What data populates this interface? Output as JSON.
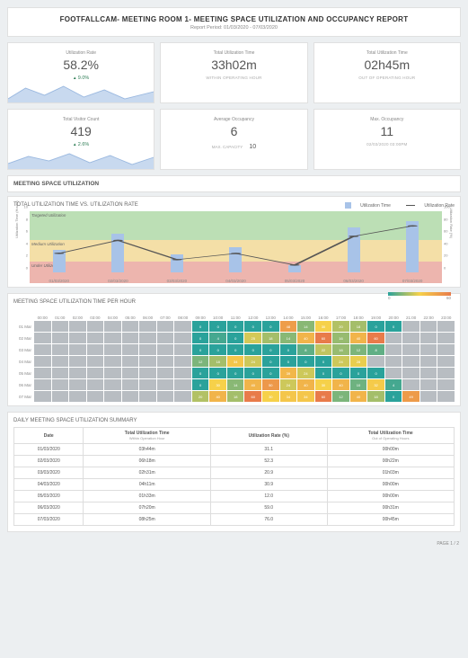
{
  "header": {
    "title": "FOOTFALLCAM- MEETING ROOM 1- MEETING SPACE UTILIZATION AND OCCUPANCY REPORT",
    "period": "Report Period: 01/03/2020 - 07/03/2020"
  },
  "kpi": {
    "util_rate": {
      "label": "Utilization Rate",
      "value": "58.2%",
      "delta": "9.0%",
      "spark": true
    },
    "util_time_in": {
      "label": "Total Utilization Time",
      "value": "33h02m",
      "sub": "WITHIN OPERATING HOUR"
    },
    "util_time_out": {
      "label": "Total Utilization Time",
      "value": "02h45m",
      "sub": "OUT OF OPERATING HOUR"
    },
    "visitor": {
      "label": "Total Visitor Count",
      "value": "419",
      "delta": "2.6%",
      "spark": true
    },
    "avg_occ": {
      "label": "Average Occupancy",
      "value": "6",
      "cap_label": "MAX. CAPACITY",
      "cap_value": "10"
    },
    "max_occ": {
      "label": "Max. Occupancy",
      "value": "11",
      "sub": "02/03/2020 03:00PM"
    }
  },
  "sections": {
    "util_title": "MEETING SPACE UTILIZATION",
    "chart1_title": "TOTAL UTILIZATION TIME VS. UTILIZATION RATE",
    "chart2_title": "MEETING SPACE UTILIZATION TIME PER HOUR",
    "table_title": "DAILY MEETING SPACE UTILIZATION SUMMARY"
  },
  "legend1": {
    "a": "Utilization Time",
    "b": "Utilization Rate"
  },
  "bands": {
    "target": "Targeted Utilization",
    "medium": "Medium Utilization",
    "under": "Under Utilized"
  },
  "axis_left_label": "Utilization Time (Hours)",
  "axis_right_label": "Utilization Rate (%)",
  "heat_legend": {
    "min": "0",
    "max": "60"
  },
  "chart_data": {
    "type": "bar",
    "categories": [
      "01/03/2020",
      "02/03/2020",
      "03/03/2020",
      "04/03/2020",
      "05/03/2020",
      "06/03/2020",
      "07/03/2020"
    ],
    "series": [
      {
        "name": "Utilization Time (h)",
        "values": [
          3.7,
          6.3,
          2.9,
          4.1,
          1.2,
          7.4,
          8.4
        ]
      },
      {
        "name": "Utilization Rate (%)",
        "values": [
          31.1,
          52.3,
          20.9,
          30.9,
          12.0,
          59.0,
          76.0
        ]
      }
    ],
    "ylim_hours": [
      0,
      10
    ],
    "ylim_rate": [
      0,
      100
    ],
    "y_ticks_left": [
      0,
      2,
      4,
      6,
      8,
      10
    ],
    "y_ticks_right": [
      0,
      20,
      40,
      60,
      80,
      100
    ]
  },
  "heatmap": {
    "hours": [
      "00:00",
      "01:00",
      "02:00",
      "03:00",
      "04:00",
      "05:00",
      "06:00",
      "07:00",
      "08:00",
      "09:00",
      "10:00",
      "11:00",
      "12:00",
      "13:00",
      "14:00",
      "15:00",
      "16:00",
      "17:00",
      "18:00",
      "19:00",
      "20:00",
      "21:00",
      "22:00",
      "23:00"
    ],
    "rows": [
      {
        "label": "01 Mar",
        "cells": [
          -1,
          -1,
          -1,
          -1,
          -1,
          -1,
          -1,
          -1,
          -1,
          0,
          0,
          0,
          0,
          0,
          48,
          14,
          30,
          20,
          18,
          0,
          0,
          -1,
          -1,
          -1
        ]
      },
      {
        "label": "02 Mar",
        "cells": [
          -1,
          -1,
          -1,
          -1,
          -1,
          -1,
          -1,
          -1,
          -1,
          0,
          4,
          0,
          25,
          18,
          14,
          40,
          60,
          16,
          40,
          60,
          -1,
          -1,
          -1,
          -1
        ]
      },
      {
        "label": "03 Mar",
        "cells": [
          -1,
          -1,
          -1,
          -1,
          -1,
          -1,
          -1,
          -1,
          -1,
          0,
          0,
          0,
          0,
          0,
          0,
          8,
          22,
          16,
          12,
          8,
          -1,
          -1,
          -1,
          -1
        ]
      },
      {
        "label": "04 Mar",
        "cells": [
          -1,
          -1,
          -1,
          -1,
          -1,
          -1,
          -1,
          -1,
          -1,
          12,
          18,
          34,
          24,
          0,
          0,
          0,
          0,
          24,
          28,
          -1,
          -1,
          -1,
          -1,
          -1
        ]
      },
      {
        "label": "05 Mar",
        "cells": [
          -1,
          -1,
          -1,
          -1,
          -1,
          -1,
          -1,
          -1,
          -1,
          0,
          0,
          0,
          0,
          0,
          39,
          24,
          0,
          0,
          0,
          0,
          -1,
          -1,
          -1,
          -1
        ]
      },
      {
        "label": "06 Mar",
        "cells": [
          -1,
          -1,
          -1,
          -1,
          -1,
          -1,
          -1,
          -1,
          -1,
          0,
          30,
          14,
          40,
          50,
          24,
          40,
          30,
          40,
          10,
          32,
          4,
          -1,
          -1,
          -1
        ]
      },
      {
        "label": "07 Mar",
        "cells": [
          -1,
          -1,
          -1,
          -1,
          -1,
          -1,
          -1,
          -1,
          -1,
          20,
          40,
          18,
          60,
          30,
          34,
          34,
          60,
          12,
          40,
          18,
          0,
          49,
          -1,
          -1
        ]
      }
    ]
  },
  "table": {
    "headers": {
      "date": "Date",
      "time": "Total Utilization Time",
      "time_sub": "Within Operation Hour",
      "rate": "Utilization Rate (%)",
      "out": "Total Utilization Time",
      "out_sub": "Out of Operating Hours"
    },
    "rows": [
      {
        "date": "01/03/2020",
        "time": "03h44m",
        "rate": "31.1",
        "out": "00h00m"
      },
      {
        "date": "02/03/2020",
        "time": "06h18m",
        "rate": "52.3",
        "out": "00h22m"
      },
      {
        "date": "03/03/2020",
        "time": "02h31m",
        "rate": "20.9",
        "out": "01h03m"
      },
      {
        "date": "04/03/2020",
        "time": "04h11m",
        "rate": "30.9",
        "out": "00h00m"
      },
      {
        "date": "05/03/2020",
        "time": "01h33m",
        "rate": "12.0",
        "out": "00h00m"
      },
      {
        "date": "06/03/2020",
        "time": "07h20m",
        "rate": "59.0",
        "out": "00h31m"
      },
      {
        "date": "07/03/2020",
        "time": "08h25m",
        "rate": "76.0",
        "out": "00h45m"
      }
    ]
  },
  "footer": {
    "page": "PAGE 1 / 2"
  }
}
